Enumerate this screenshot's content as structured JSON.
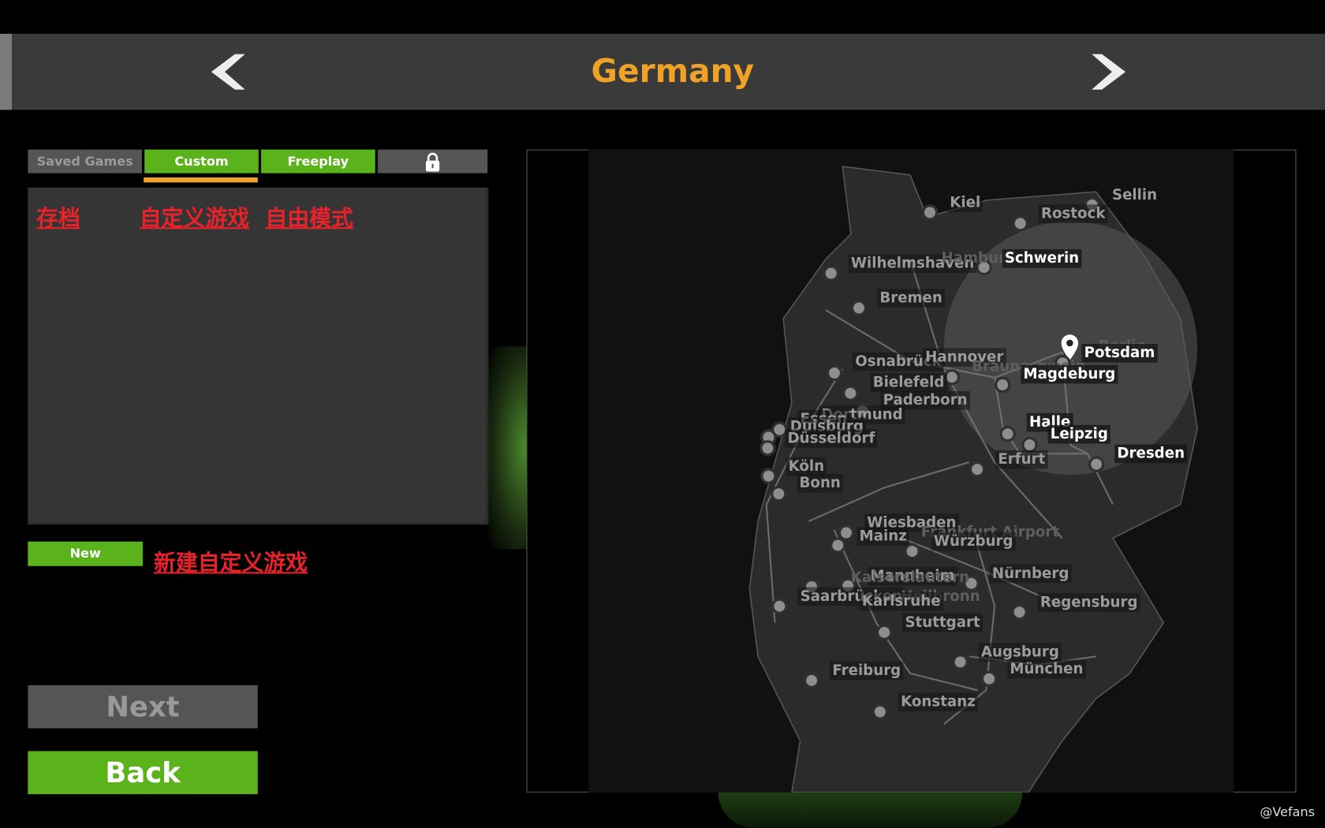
{
  "header": {
    "title": "Germany",
    "prev_icon": "chevron-left-icon",
    "next_icon": "chevron-right-icon"
  },
  "tabs": [
    {
      "label": "Saved Games",
      "state": "disabled"
    },
    {
      "label": "Custom",
      "state": "selected"
    },
    {
      "label": "Freeplay",
      "state": "enabled"
    },
    {
      "label": "",
      "icon": "lock-icon",
      "state": "locked"
    }
  ],
  "annotations": {
    "saved": "存档",
    "custom": "自定义游戏",
    "freeplay": "自由模式",
    "new": "新建自定义游戏"
  },
  "buttons": {
    "new": "New",
    "next": "Next",
    "back": "Back"
  },
  "colors": {
    "accent": "#f0a227",
    "green": "#5ab31a",
    "annotation": "#e8222a"
  },
  "map": {
    "selected_city": "Potsdam",
    "cities": [
      {
        "name": "Kiel"
      },
      {
        "name": "Sellin"
      },
      {
        "name": "Rostock"
      },
      {
        "name": "Wilhelmshaven"
      },
      {
        "name": "Hamburg",
        "faded": true
      },
      {
        "name": "Schwerin",
        "hl": true
      },
      {
        "name": "Bremen"
      },
      {
        "name": "Berlin",
        "faded": true
      },
      {
        "name": "Potsdam",
        "hl": true
      },
      {
        "name": "Osnabrück"
      },
      {
        "name": "Hannover"
      },
      {
        "name": "Braunschweig",
        "faded": true
      },
      {
        "name": "Magdeburg",
        "hl": true
      },
      {
        "name": "Bielefeld"
      },
      {
        "name": "Paderborn"
      },
      {
        "name": "Dortmund"
      },
      {
        "name": "Essen"
      },
      {
        "name": "Duisburg"
      },
      {
        "name": "Düsseldorf"
      },
      {
        "name": "Halle",
        "hl": true
      },
      {
        "name": "Leipzig",
        "hl": true
      },
      {
        "name": "Dresden",
        "hl": true
      },
      {
        "name": "Erfurt"
      },
      {
        "name": "Köln"
      },
      {
        "name": "Bonn"
      },
      {
        "name": "Wiesbaden"
      },
      {
        "name": "Frankfurt Airport",
        "faded": true
      },
      {
        "name": "Mainz"
      },
      {
        "name": "Würzburg"
      },
      {
        "name": "Nürnberg"
      },
      {
        "name": "Mannheim"
      },
      {
        "name": "Kaiserslautern",
        "faded": true
      },
      {
        "name": "Saarbrücken"
      },
      {
        "name": "Heilbronn",
        "faded": true
      },
      {
        "name": "Karlsruhe"
      },
      {
        "name": "Regensburg"
      },
      {
        "name": "Stuttgart"
      },
      {
        "name": "Augsburg"
      },
      {
        "name": "Freiburg"
      },
      {
        "name": "München"
      },
      {
        "name": "Konstanz"
      }
    ]
  },
  "watermark": "@Vefans"
}
